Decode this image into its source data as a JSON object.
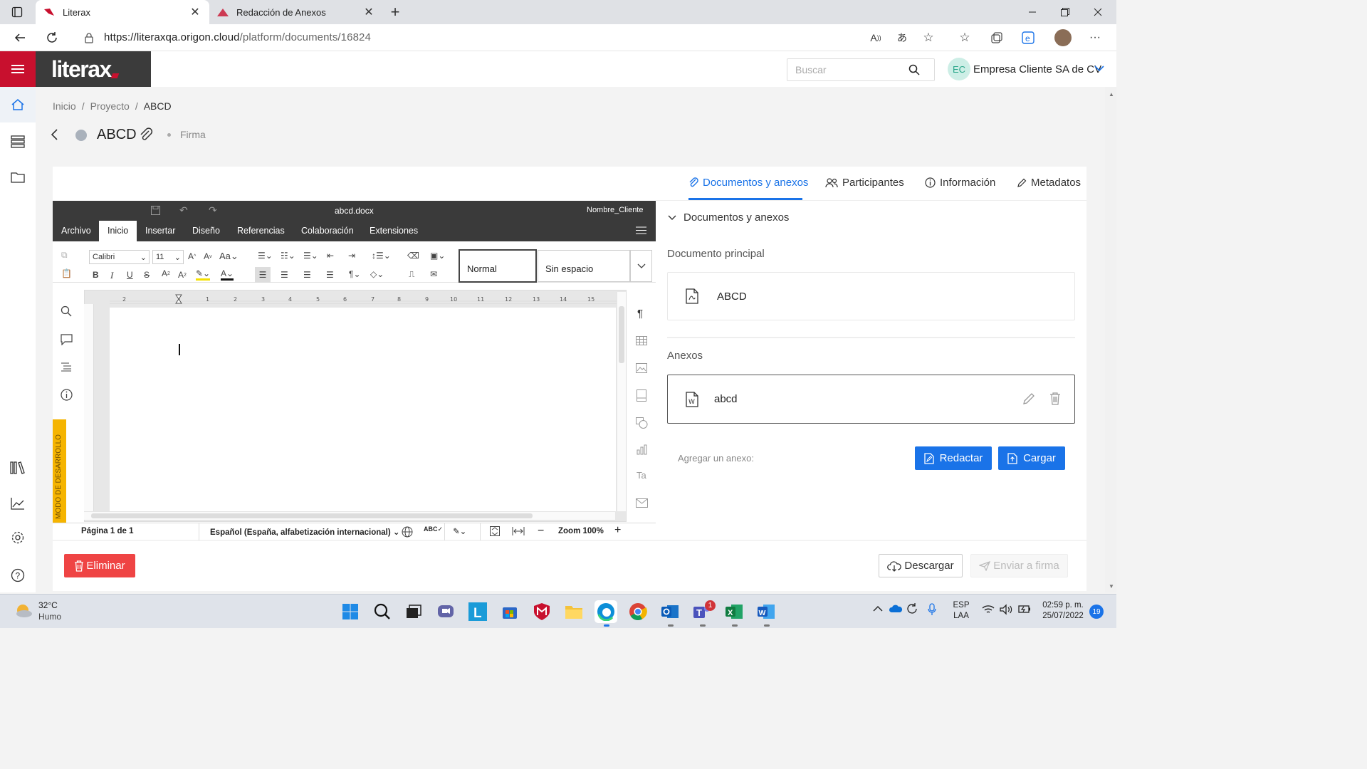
{
  "browser": {
    "tabs": [
      {
        "title": "Literax",
        "active": true
      },
      {
        "title": "Redacción de Anexos",
        "active": false
      }
    ],
    "url": {
      "host": "https://literaxqa.origon.cloud",
      "path": "/platform/documents/16824"
    }
  },
  "app": {
    "logo": "literax",
    "search_placeholder": "Buscar",
    "user_initials": "EC",
    "company": "Empresa Cliente SA de CV"
  },
  "breadcrumb": [
    "Inicio",
    "Proyecto",
    "ABCD"
  ],
  "document": {
    "title": "ABCD",
    "stage": "Firma"
  },
  "editor": {
    "filename": "abcd.docx",
    "client_field": "Nombre_Cliente",
    "menu": [
      "Archivo",
      "Inicio",
      "Insertar",
      "Diseño",
      "Referencias",
      "Colaboración",
      "Extensiones"
    ],
    "selected_menu": "Inicio",
    "font": "Calibri",
    "font_size": "11",
    "styles": [
      "Normal",
      "Sin espacio"
    ],
    "dev_mode_label": "MODO DE DESARROLLO",
    "status": {
      "page": "Página 1 de 1",
      "language": "Español (España, alfabetización internacional)",
      "zoom": "Zoom 100%"
    }
  },
  "panel": {
    "tabs": [
      "Documentos y anexos",
      "Participantes",
      "Información",
      "Metadatos"
    ],
    "section_title": "Documentos y anexos",
    "main_doc_heading": "Documento principal",
    "main_doc_name": "ABCD",
    "annex_heading": "Anexos",
    "annex_name": "abcd",
    "add_annex_label": "Agregar un anexo:",
    "btn_write": "Redactar",
    "btn_upload": "Cargar"
  },
  "actions": {
    "delete": "Eliminar",
    "download": "Descargar",
    "send": "Enviar a firma"
  },
  "taskbar": {
    "weather_temp": "32°C",
    "weather_desc": "Humo",
    "lang_top": "ESP",
    "lang_bottom": "LAA",
    "time": "02:59 p. m.",
    "date": "25/07/2022",
    "notifications": "19",
    "teams_badge": "1"
  },
  "colors": {
    "brand_red": "#c8102e",
    "accent_blue": "#1a73e8",
    "danger": "#ef4444",
    "logo_bg": "#3b3b3b"
  }
}
